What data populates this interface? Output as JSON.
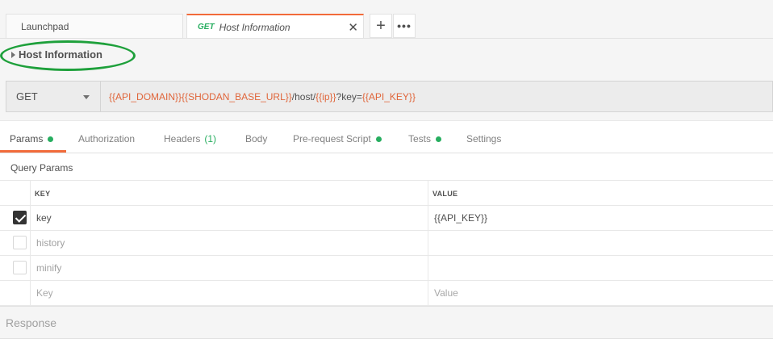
{
  "tabs": {
    "launchpad_label": "Launchpad",
    "active_method": "GET",
    "active_name": "Host Information",
    "close_glyph": "✕",
    "add_glyph": "+",
    "more_glyph": "•••"
  },
  "request": {
    "title": "Host Information",
    "method": "GET",
    "url": {
      "part1": "{{API_DOMAIN}}{{SHODAN_BASE_URL}}",
      "part2": "/host/",
      "part3": "{{ip}}",
      "part4": "?key=",
      "part5": "{{API_KEY}}"
    }
  },
  "request_tabs": {
    "params": "Params",
    "authorization": "Authorization",
    "headers": "Headers",
    "headers_count": "(1)",
    "body": "Body",
    "prerequest": "Pre-request Script",
    "tests": "Tests",
    "settings": "Settings"
  },
  "query_params": {
    "label": "Query Params",
    "col_key": "KEY",
    "col_value": "VALUE",
    "rows": [
      {
        "key": "key",
        "value": "{{API_KEY}}",
        "checked": true
      },
      {
        "key": "history",
        "value": "",
        "checked": false
      },
      {
        "key": "minify",
        "value": "",
        "checked": false
      }
    ],
    "key_placeholder": "Key",
    "value_placeholder": "Value"
  },
  "response": {
    "label": "Response"
  },
  "colors": {
    "accent": "#f26b3a",
    "variable": "#e0663b",
    "success": "#27ae60",
    "annotation": "#1ea03b"
  }
}
